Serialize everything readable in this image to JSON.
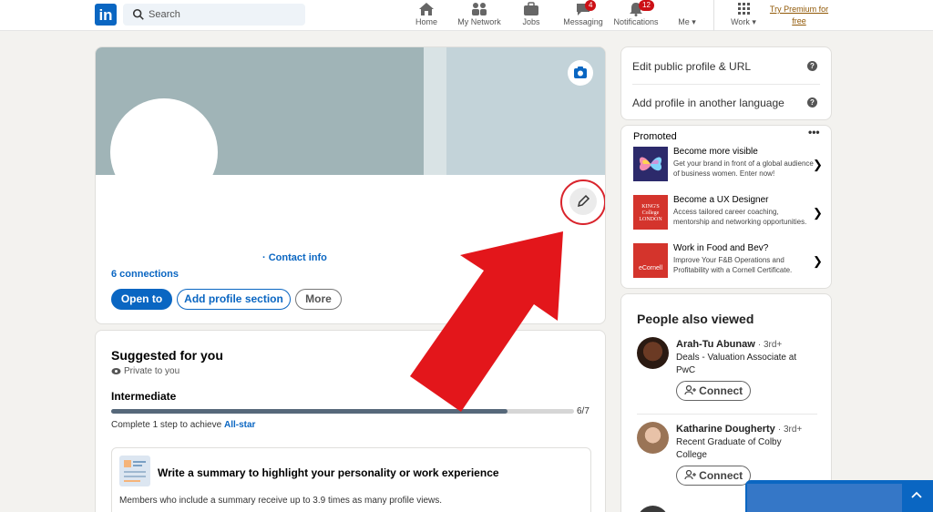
{
  "header": {
    "logo": "in",
    "search_placeholder": "Search",
    "nav": [
      {
        "label": "Home",
        "icon": "home-icon"
      },
      {
        "label": "My Network",
        "icon": "network-icon"
      },
      {
        "label": "Jobs",
        "icon": "briefcase-icon"
      },
      {
        "label": "Messaging",
        "icon": "messaging-icon",
        "badge": "4"
      },
      {
        "label": "Notifications",
        "icon": "bell-icon",
        "badge": "12"
      },
      {
        "label": "Me ▾",
        "icon": "avatar-icon"
      },
      {
        "label": "Work ▾",
        "icon": "grid-icon"
      }
    ],
    "premium_line1": "Try Premium for",
    "premium_line2": "free"
  },
  "profile": {
    "contact_info": "· Contact info",
    "connections": "6 connections",
    "buttons": {
      "open_to": "Open to",
      "add_section": "Add profile section",
      "more": "More"
    }
  },
  "suggested": {
    "title": "Suggested for you",
    "private": "Private to you",
    "level": "Intermediate",
    "progress_value": 6,
    "progress_total": 7,
    "progress_label": "6/7",
    "complete_prefix": "Complete 1 step to achieve ",
    "complete_link": "All-star",
    "card_title": "Write a summary to highlight your personality or work experience",
    "card_desc": "Members who include a summary receive up to 3.9 times as many profile views."
  },
  "right": {
    "edit_public": "Edit public profile & URL",
    "add_language": "Add profile in another language",
    "promoted": "Promoted",
    "more_dots": "•••",
    "ads": [
      {
        "title": "Become more visible",
        "desc": "Get your brand in front of a global audience of business women. Enter now!"
      },
      {
        "title": "Become a UX Designer",
        "desc": "Access tailored career coaching, mentorship and networking opportunities."
      },
      {
        "title": "Work in Food and Bev?",
        "desc": "Improve Your F&B Operations and Profitability with a Cornell Certificate."
      }
    ],
    "ad_logo_texts": [
      "KING'S College LONDON",
      "eCornell"
    ],
    "people_title": "People also viewed",
    "people": [
      {
        "name": "Arah-Tu Abunaw",
        "degree": "· 3rd+",
        "headline": "Deals - Valuation Associate at PwC",
        "connect": "Connect"
      },
      {
        "name": "Katharine Dougherty",
        "degree": "· 3rd+",
        "headline": "Recent Graduate of Colby College",
        "connect": "Connect"
      }
    ]
  },
  "colors": {
    "brand": "#0a66c2",
    "annotation_arrow": "#e3161b",
    "premium": "#915907"
  }
}
